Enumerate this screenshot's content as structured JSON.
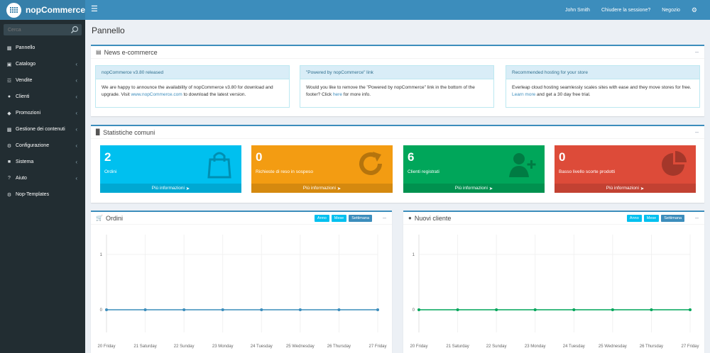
{
  "header": {
    "logo_text": "nopCommerce",
    "user_name": "John Smith",
    "logout": "Chiudere la sessione?",
    "store": "Negozio"
  },
  "sidebar": {
    "search_placeholder": "Cerca",
    "items": [
      {
        "label": "Pannello",
        "icon": "desktop-icon",
        "chevron": false
      },
      {
        "label": "Catalogo",
        "icon": "book-icon",
        "chevron": true
      },
      {
        "label": "Vendite",
        "icon": "cart-icon",
        "chevron": true
      },
      {
        "label": "Clienti",
        "icon": "user-icon",
        "chevron": true
      },
      {
        "label": "Promozioni",
        "icon": "tag-icon",
        "chevron": true
      },
      {
        "label": "Gestione dei contenuti",
        "icon": "cubes-icon",
        "chevron": true
      },
      {
        "label": "Configurazione",
        "icon": "gears-icon",
        "chevron": true
      },
      {
        "label": "Sistema",
        "icon": "cube-icon",
        "chevron": true
      },
      {
        "label": "Aiuto",
        "icon": "question-icon",
        "chevron": true
      },
      {
        "label": "Nop-Templates",
        "icon": "gear-icon",
        "chevron": false
      }
    ]
  },
  "main": {
    "page_title": "Pannello",
    "news": {
      "title": "News e-commerce",
      "items": [
        {
          "title": "nopCommerce v3.80 released",
          "before": "We are happy to announce the availability of nopCommerce v3.80 for download and upgrade. Visit ",
          "link": "www.nopCommerce.com",
          "after": " to download the latest version."
        },
        {
          "title": "\"Powered by nopCommerce\" link",
          "before": "Would you like to remove the \"Powered by nopCommerce\" link in the bottom of the footer? Click ",
          "link": "here",
          "after": " for more info."
        },
        {
          "title": "Recommended hosting for your store",
          "before": "Everleap cloud hosting seamlessly scales sites with ease and they move stores for free. ",
          "link": "Learn more",
          "after": " and get a 30 day free trial."
        }
      ]
    },
    "stats": {
      "title": "Statistiche comuni",
      "more_label": "Più informazioni",
      "tiles": [
        {
          "value": "2",
          "label": "Ordini",
          "color": "#00c0ef",
          "icon": "shopping-bag-icon"
        },
        {
          "value": "0",
          "label": "Richieste di reso in sospeso",
          "color": "#f39c12",
          "icon": "refresh-icon"
        },
        {
          "value": "6",
          "label": "Clienti registrati",
          "color": "#00a65a",
          "icon": "user-plus-icon"
        },
        {
          "value": "0",
          "label": "Basso livello scorte prodotti",
          "color": "#dd4b39",
          "icon": "pie-chart-icon"
        }
      ]
    },
    "range_buttons": {
      "year": "Anno",
      "month": "Mese",
      "week": "Settimana"
    }
  },
  "chart_data": [
    {
      "type": "line",
      "title": "Ordini",
      "categories": [
        "20 Friday",
        "21 Saturday",
        "22 Sunday",
        "23 Monday",
        "24 Tuesday",
        "25 Wednesday",
        "26 Thursday",
        "27 Friday"
      ],
      "series": [
        {
          "values": [
            0,
            0,
            0,
            0,
            0,
            0,
            0,
            0
          ],
          "color": "#3c8dbc"
        }
      ],
      "ylim": [
        0,
        1
      ],
      "yticks": [
        "1",
        "0"
      ],
      "grid": true
    },
    {
      "type": "line",
      "title": "Nuovi cliente",
      "categories": [
        "20 Friday",
        "21 Saturday",
        "22 Sunday",
        "23 Monday",
        "24 Tuesday",
        "25 Wednesday",
        "26 Thursday",
        "27 Friday"
      ],
      "series": [
        {
          "values": [
            0,
            0,
            0,
            0,
            0,
            0,
            0,
            0
          ],
          "color": "#00a65a"
        }
      ],
      "ylim": [
        0,
        1
      ],
      "yticks": [
        "1",
        "0"
      ],
      "grid": true
    }
  ]
}
